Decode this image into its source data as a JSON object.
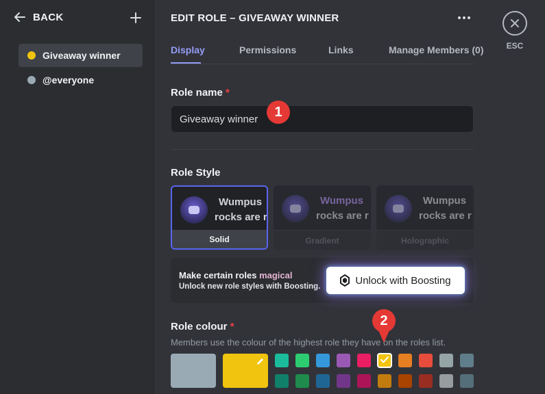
{
  "sidebar": {
    "back_label": "BACK",
    "roles": [
      {
        "label": "Giveaway winner",
        "color": "#f1c40f"
      },
      {
        "label": "@everyone",
        "color": "#99aab5"
      }
    ]
  },
  "header": {
    "title": "EDIT ROLE – GIVEAWAY WINNER"
  },
  "tabs": [
    "Display",
    "Permissions",
    "Links",
    "Manage Members (0)"
  ],
  "role_name": {
    "label": "Role name",
    "required_mark": "*",
    "value": "Giveaway winner"
  },
  "role_style": {
    "label": "Role Style",
    "preview_line1": "Wumpus",
    "preview_line2": "rocks are r",
    "options": [
      "Solid",
      "Gradient",
      "Holographic"
    ]
  },
  "boost": {
    "heading_prefix": "Make certain roles",
    "heading_magic": "magical",
    "subtext": "Unlock new role styles with Boosting.",
    "button_label": "Unlock with Boosting"
  },
  "role_colour": {
    "label": "Role colour",
    "required_mark": "*",
    "description": "Members use the colour of the highest role they have on the roles list.",
    "default_color": "#99aab5",
    "custom_color": "#f1c40f",
    "selected_color": "#f1c40f",
    "swatches_row1": [
      "#1abc9c",
      "#2ecc71",
      "#3498db",
      "#9b59b6",
      "#e91e63",
      "#f1c40f",
      "#e67e22",
      "#e74c3c",
      "#95a5a6",
      "#607d8b"
    ],
    "swatches_row2": [
      "#11806a",
      "#1f8b4c",
      "#206694",
      "#71368a",
      "#ad1457",
      "#c27c0e",
      "#a84300",
      "#992d22",
      "#979c9f",
      "#546e7a"
    ]
  },
  "annotations": [
    "1",
    "2"
  ],
  "esc_label": "ESC"
}
